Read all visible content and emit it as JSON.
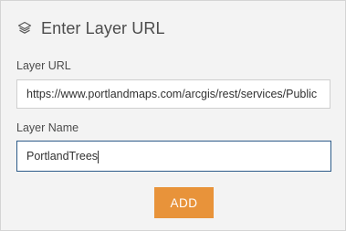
{
  "header": {
    "icon": "layers-icon",
    "title": "Enter Layer URL"
  },
  "layer_url": {
    "label": "Layer URL",
    "value": "https://www.portlandmaps.com/arcgis/rest/services/Public"
  },
  "layer_name": {
    "label": "Layer Name",
    "value": "PortlandTrees"
  },
  "actions": {
    "add_label": "ADD"
  },
  "colors": {
    "panel_bg": "#f3f3f3",
    "accent_button": "#e8933a",
    "focus_border": "#2d5b89",
    "text": "#4c4c4c"
  }
}
